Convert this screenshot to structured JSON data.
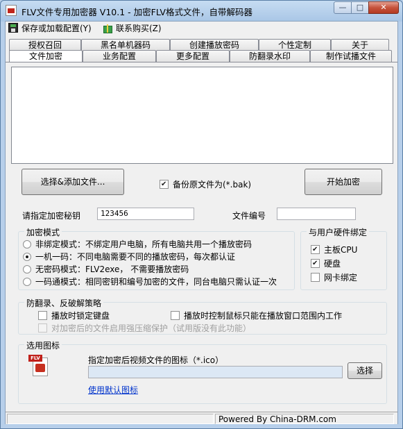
{
  "window": {
    "title": "FLV文件专用加密器 V10.1 - 加密FLV格式文件，自带解码器",
    "minimize_icon": "minimize-icon",
    "maximize_icon": "maximize-icon",
    "close_icon": "close-icon"
  },
  "menu": {
    "save_load": "保存或加载配置(Y)",
    "contact": "联系购买(Z)"
  },
  "tabs": {
    "row1": [
      "授权召回",
      "黑名单机器码",
      "创建播放密码",
      "个性定制",
      "关于"
    ],
    "row2": [
      "文件加密",
      "业务配置",
      "更多配置",
      "防翻录水印",
      "制作试播文件"
    ],
    "active": "文件加密"
  },
  "actions": {
    "select_add": "选择&添加文件...",
    "backup_label": "备份原文件为(*.bak)",
    "backup_checked": true,
    "start": "开始加密"
  },
  "fields": {
    "key_label": "请指定加密秘钥",
    "key_value": "123456",
    "fileno_label": "文件编号",
    "fileno_value": ""
  },
  "encrypt_mode": {
    "title": "加密模式",
    "options": [
      {
        "label": "非绑定模式：不绑定用户电脑，所有电脑共用一个播放密码",
        "selected": false
      },
      {
        "label": "一机一码：不同电脑需要不同的播放密码，每次都认证",
        "selected": true
      },
      {
        "label": "无密码模式：FLV2exe， 不需要播放密码",
        "selected": false
      },
      {
        "label": "一码通模式：相同密钥和编号加密的文件，同台电脑只需认证一次",
        "selected": false
      }
    ]
  },
  "hardware": {
    "title": "与用户硬件绑定",
    "items": [
      {
        "label": "主板CPU",
        "checked": true
      },
      {
        "label": "硬盘",
        "checked": true
      },
      {
        "label": "网卡绑定",
        "checked": false
      }
    ]
  },
  "anti_record": {
    "title": "防翻录、反破解策略",
    "lock_keyboard": "播放时锁定键盘",
    "mouse_limit": "播放时控制鼠标只能在播放窗口范围内工作",
    "compression": "对加密后的文件启用强压缩保护（试用版没有此功能）"
  },
  "icon_section": {
    "title": "选用图标",
    "desc": "指定加密后视频文件的图标（*.ico）",
    "path_value": "",
    "choose": "选择",
    "default_link": "使用默认图标",
    "icon_tag": "FLV"
  },
  "status": {
    "powered": "Powered By China-DRM.com"
  }
}
